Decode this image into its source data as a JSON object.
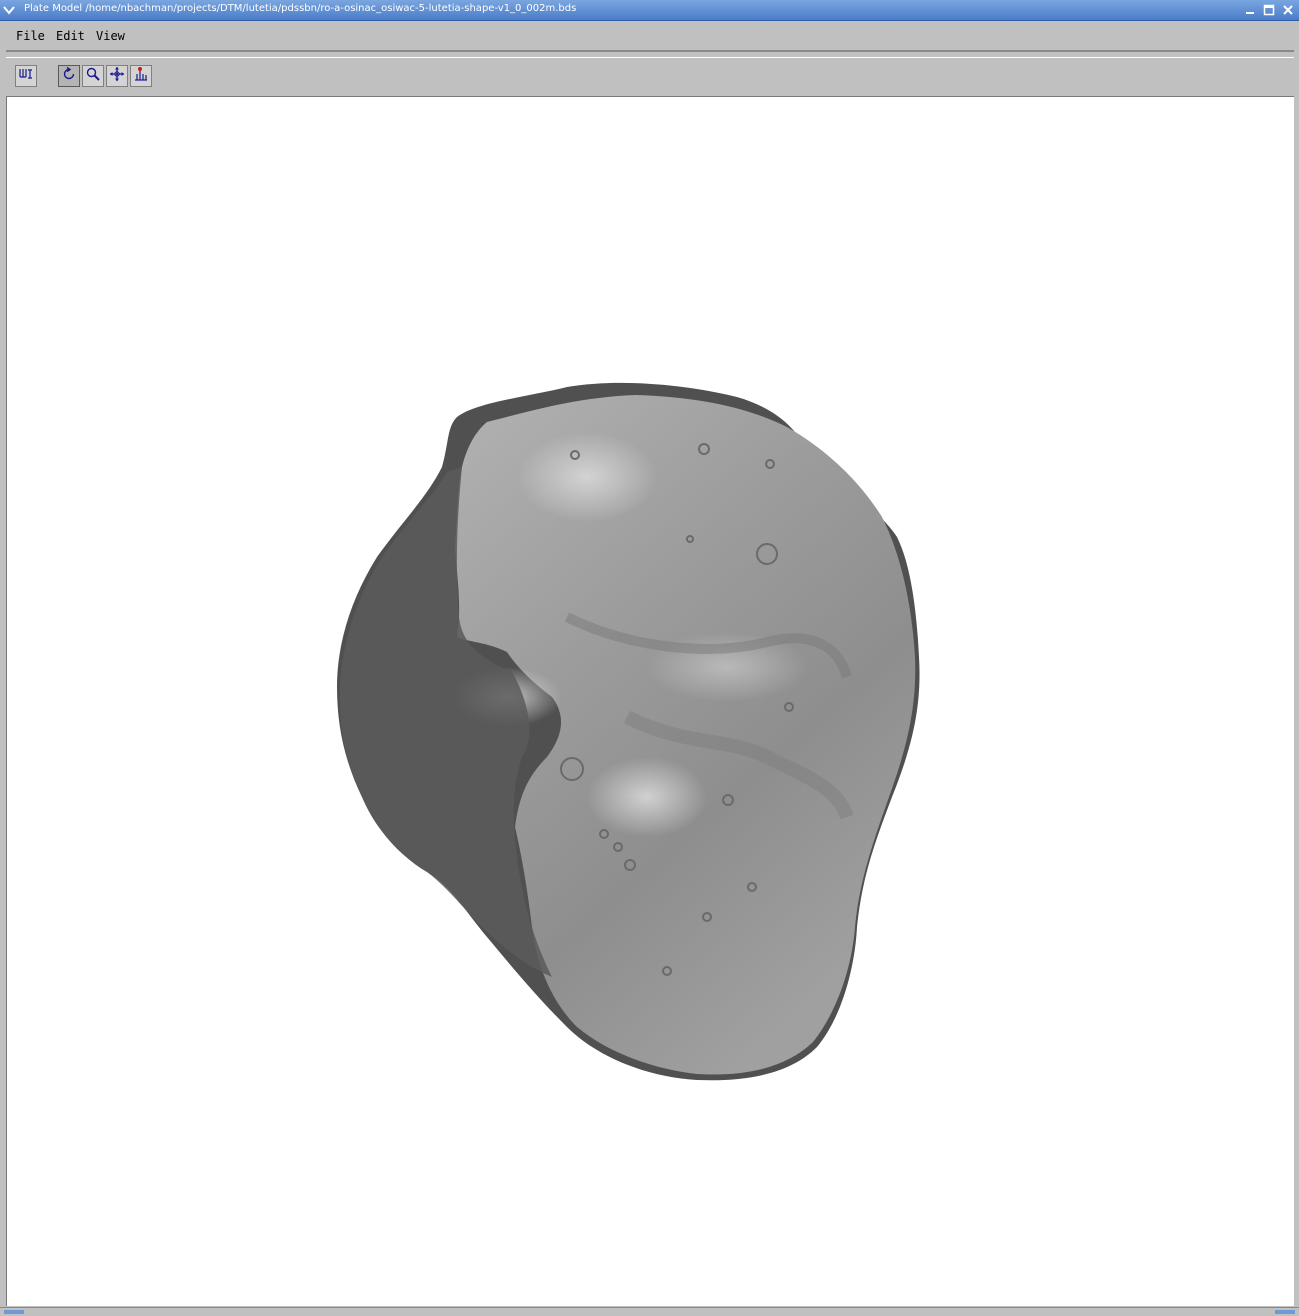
{
  "window": {
    "title": "Plate Model /home/nbachman/projects/DTM/lutetia/pdssbn/ro-a-osinac_osiwac-5-lutetia-shape-v1_0_002m.bds",
    "controls": [
      "minimize-icon",
      "maximize-icon",
      "close-icon"
    ]
  },
  "menubar": {
    "items": [
      {
        "label": "File"
      },
      {
        "label": "Edit"
      },
      {
        "label": "View"
      }
    ]
  },
  "toolbar": {
    "buttons": [
      {
        "icon": "plate-model-icon",
        "active": false
      },
      {
        "icon": "rotate-icon",
        "active": true
      },
      {
        "icon": "zoom-icon",
        "active": false
      },
      {
        "icon": "pan-icon",
        "active": false
      },
      {
        "icon": "pick-point-icon",
        "active": false
      }
    ]
  },
  "viewport": {
    "content": "3D shaded rendering of asteroid shape model",
    "background": "#ffffff",
    "model_color": "#8c8c8c"
  },
  "colors": {
    "titlebar": "#4a7cc8",
    "chrome": "#c0c0c0"
  }
}
